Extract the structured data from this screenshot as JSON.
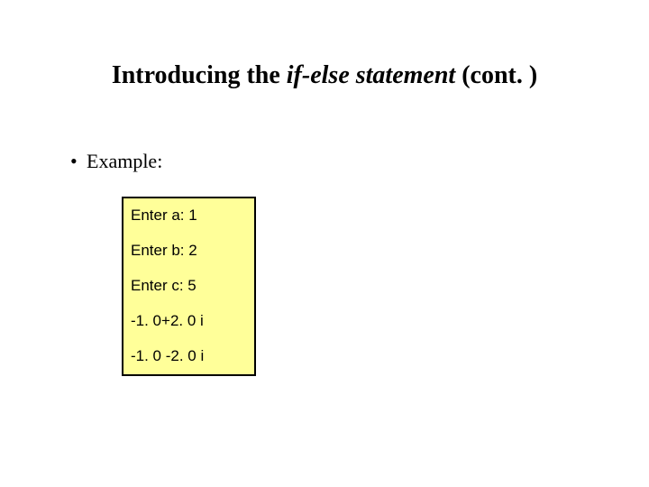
{
  "title": {
    "prefix": "Introducing the ",
    "emphasis": "if-else statement",
    "suffix": " (cont. )"
  },
  "bullet": {
    "marker": "•",
    "text": "Example:"
  },
  "code": {
    "lines": [
      "Enter a: 1",
      "Enter b: 2",
      "Enter c: 5",
      "-1. 0+2. 0 i",
      "-1. 0 -2. 0 i"
    ]
  }
}
